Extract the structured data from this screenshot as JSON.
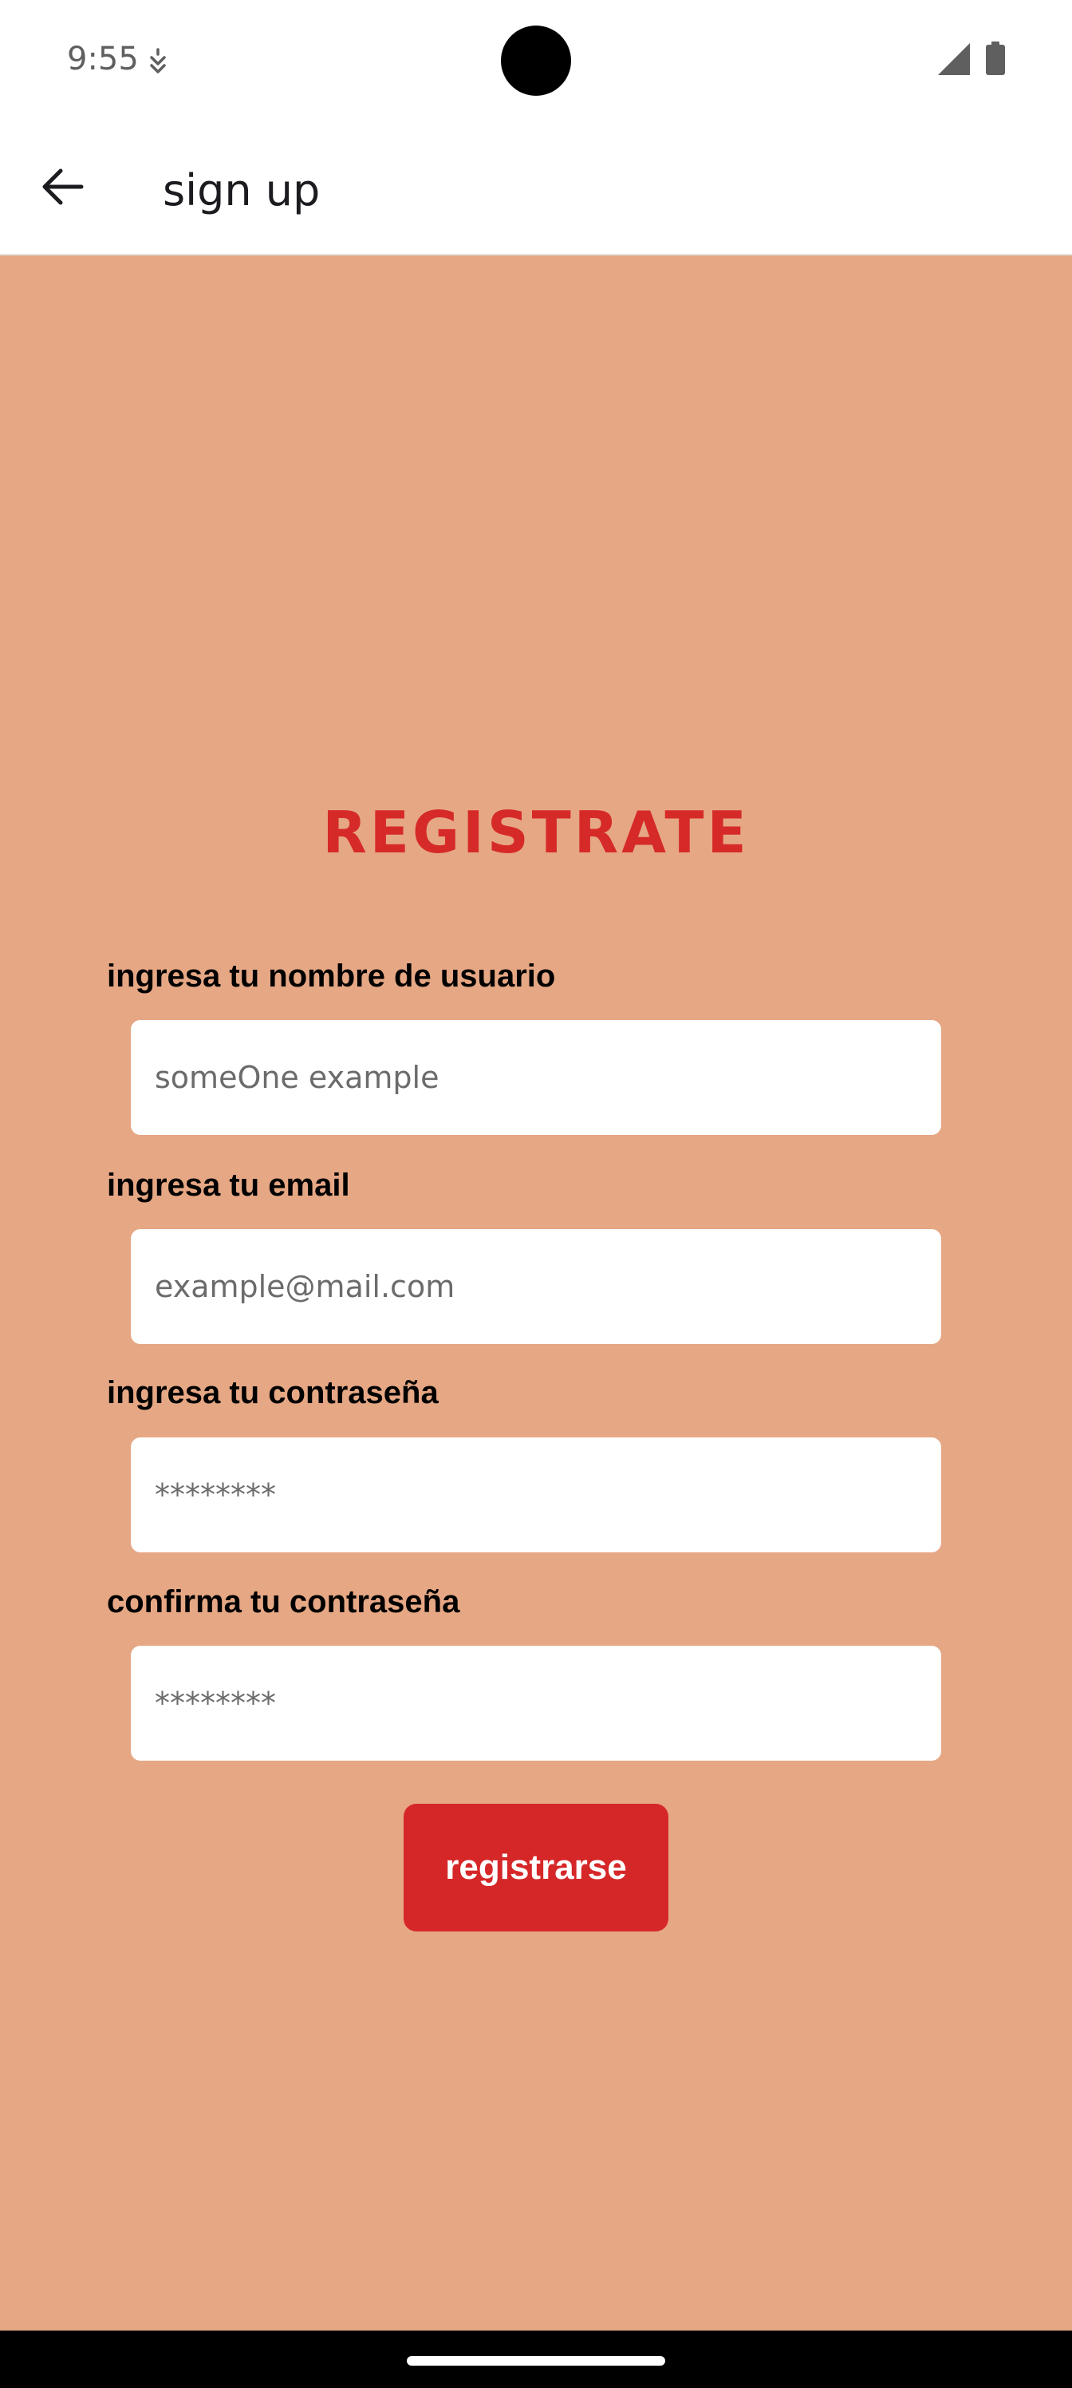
{
  "status_bar": {
    "time": "9:55",
    "icons": [
      "notification-icon",
      "cellular-signal-icon",
      "battery-icon"
    ]
  },
  "app_bar": {
    "title": "sign up",
    "back_icon": "arrow-back-icon"
  },
  "form": {
    "heading": "REGISTRATE",
    "fields": [
      {
        "label": "ingresa tu nombre de usuario",
        "placeholder": "someOne example",
        "value": ""
      },
      {
        "label": "ingresa tu email",
        "placeholder": "example@mail.com",
        "value": ""
      },
      {
        "label": "ingresa tu contraseña",
        "placeholder": "********",
        "value": ""
      },
      {
        "label": "confirma tu contraseña",
        "placeholder": "********",
        "value": ""
      }
    ],
    "submit_label": "registrarse"
  },
  "colors": {
    "background": "#e6a784",
    "accent": "#d62a29",
    "surface": "#ffffff"
  }
}
